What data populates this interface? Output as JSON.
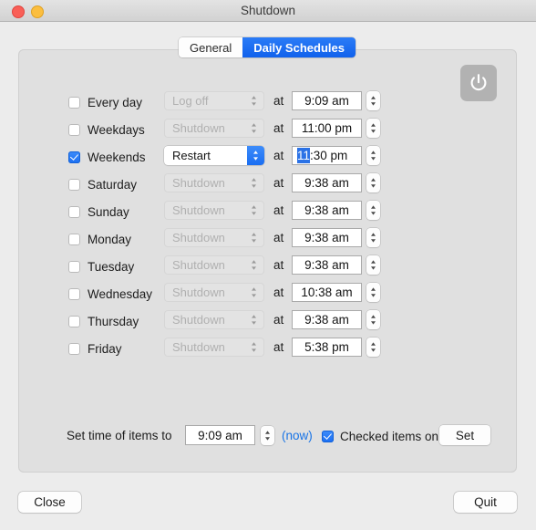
{
  "window": {
    "title": "Shutdown",
    "traffic_lights": [
      {
        "name": "close",
        "color": "#f95f57"
      },
      {
        "name": "minimize",
        "color": "#fbbe3f"
      }
    ]
  },
  "tabs": [
    {
      "label": "General",
      "active": false
    },
    {
      "label": "Daily Schedules",
      "active": true
    }
  ],
  "power_button": {
    "icon": "power-icon",
    "enabled": true
  },
  "at_label": "at",
  "schedule_rows": [
    {
      "day": "Every day",
      "checked": false,
      "action": "Log off",
      "action_enabled": false,
      "time": "9:09 am",
      "focused": false
    },
    {
      "day": "Weekdays",
      "checked": false,
      "action": "Shutdown",
      "action_enabled": false,
      "time": "11:00 pm",
      "focused": false
    },
    {
      "day": "Weekends",
      "checked": true,
      "action": "Restart",
      "action_enabled": true,
      "time": "11:30 pm",
      "focused": true,
      "selected_part": "11",
      "rest_part": ":30 pm"
    },
    {
      "day": "Saturday",
      "checked": false,
      "action": "Shutdown",
      "action_enabled": false,
      "time": "9:38 am",
      "focused": false
    },
    {
      "day": "Sunday",
      "checked": false,
      "action": "Shutdown",
      "action_enabled": false,
      "time": "9:38 am",
      "focused": false
    },
    {
      "day": "Monday",
      "checked": false,
      "action": "Shutdown",
      "action_enabled": false,
      "time": "9:38 am",
      "focused": false
    },
    {
      "day": "Tuesday",
      "checked": false,
      "action": "Shutdown",
      "action_enabled": false,
      "time": "9:38 am",
      "focused": false
    },
    {
      "day": "Wednesday",
      "checked": false,
      "action": "Shutdown",
      "action_enabled": false,
      "time": "10:38 am",
      "focused": false
    },
    {
      "day": "Thursday",
      "checked": false,
      "action": "Shutdown",
      "action_enabled": false,
      "time": "9:38 am",
      "focused": false
    },
    {
      "day": "Friday",
      "checked": false,
      "action": "Shutdown",
      "action_enabled": false,
      "time": "5:38 pm",
      "focused": false
    }
  ],
  "set_time_bar": {
    "label": "Set time of items to",
    "time_value": "9:09 am",
    "now_link": "(now)",
    "checked_items_only_label": "Checked items only",
    "checked_items_only": true,
    "set_button": "Set"
  },
  "footer": {
    "close_label": "Close",
    "quit_label": "Quit"
  },
  "colors": {
    "accent_blue": "#1a6ef2",
    "link_blue": "#1773e6",
    "window_bg": "#ececec",
    "panel_bg": "#e0e0e0",
    "disabled_text": "#b0b0b0"
  }
}
